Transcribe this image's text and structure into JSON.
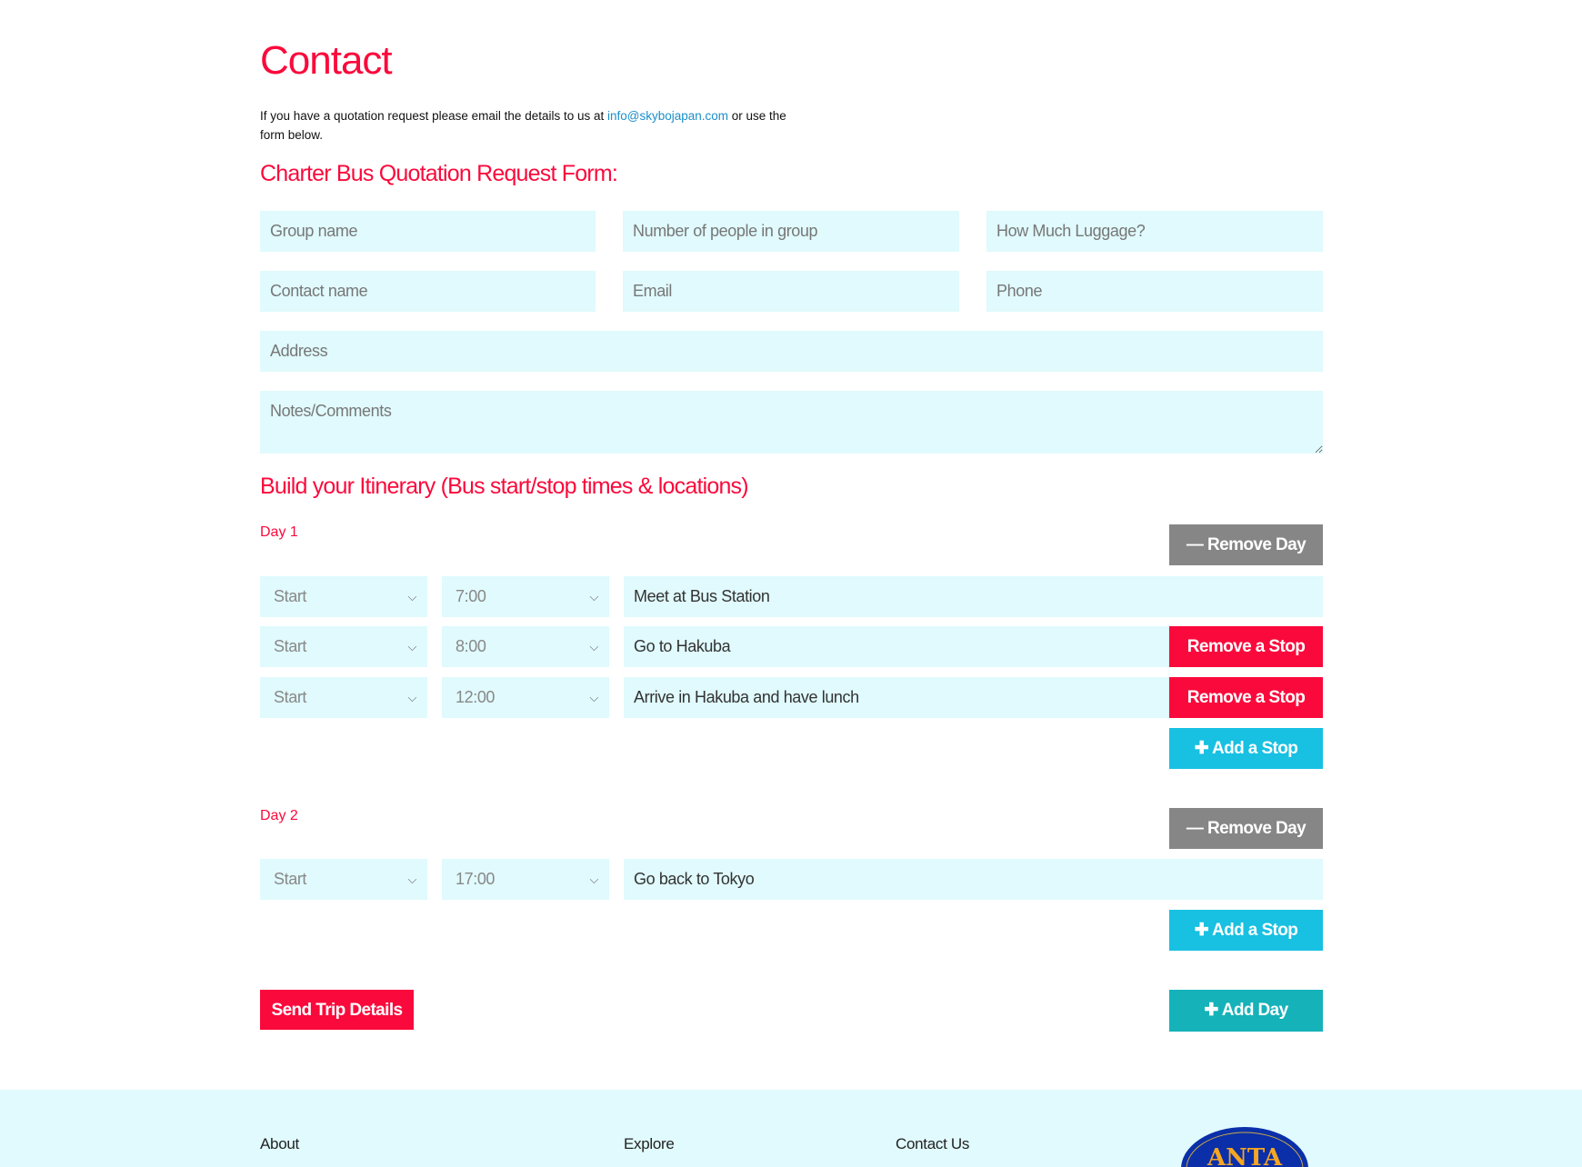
{
  "page_title": "Contact",
  "intro": {
    "text_before": "If you have a quotation request please email the details to us at ",
    "email": "info@skybojapan.com",
    "text_after": " or use the form below."
  },
  "form_title": "Charter Bus Quotation Request Form:",
  "fields": {
    "group_name": "Group name",
    "people": "Number of people in group",
    "luggage": "How Much Luggage?",
    "contact_name": "Contact name",
    "email": "Email",
    "phone": "Phone",
    "address": "Address",
    "notes": "Notes/Comments"
  },
  "itinerary_title": "Build your Itinerary (Bus start/stop times & locations)",
  "days": [
    {
      "label": "Day 1",
      "stops": [
        {
          "type": "Start",
          "time": "7:00",
          "location": "Meet at Bus Station"
        },
        {
          "type": "Start",
          "time": "8:00",
          "location": "Go to Hakuba"
        },
        {
          "type": "Start",
          "time": "12:00",
          "location": "Arrive in Hakuba and have lunch"
        }
      ]
    },
    {
      "label": "Day 2",
      "stops": [
        {
          "type": "Start",
          "time": "17:00",
          "location": "Go back to Tokyo"
        }
      ]
    }
  ],
  "buttons": {
    "remove_day": "Remove Day",
    "remove_stop": "Remove a Stop",
    "add_stop": "Add a Stop",
    "send": "Send Trip Details",
    "add_day": "Add Day"
  },
  "footer": {
    "about": "About",
    "explore": "Explore",
    "contact": "Contact Us",
    "logo_text": "ANTA"
  },
  "colors": {
    "accent": "#fa0a3c",
    "input_bg": "#e0fafd",
    "cyan": "#18c0e2",
    "teal": "#15b2b9",
    "grey": "#868686"
  }
}
